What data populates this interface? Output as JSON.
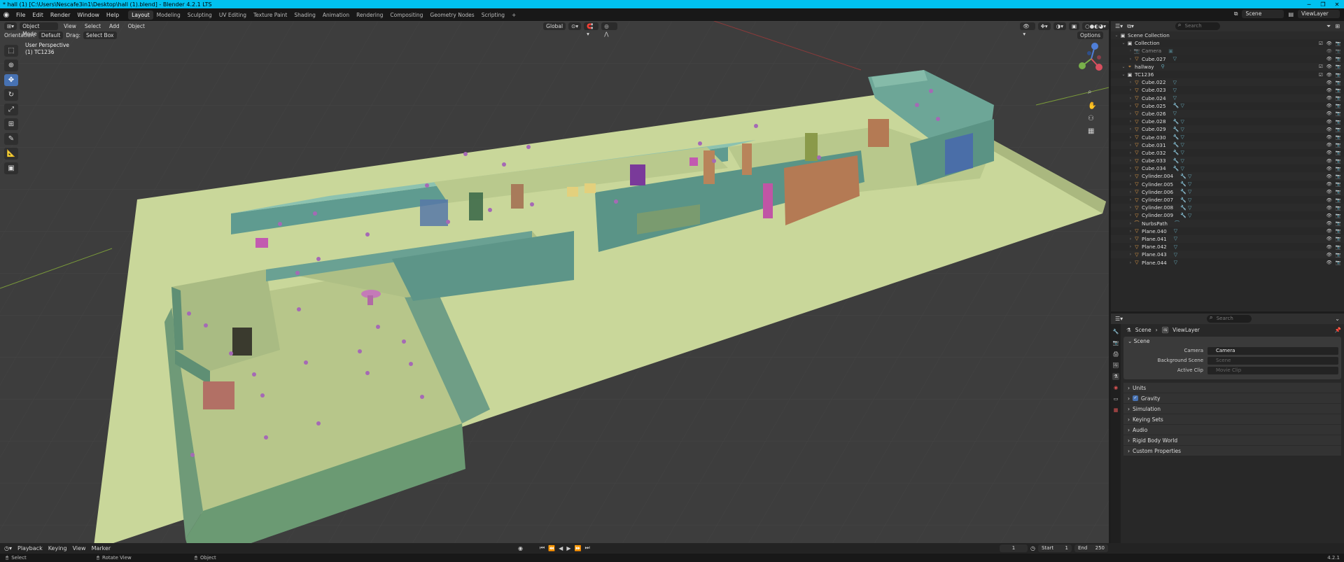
{
  "window": {
    "title": "* hall (1) [C:\\Users\\Nescafe3in1\\Desktop\\hall (1).blend] - Blender 4.2.1 LTS",
    "minimize": "─",
    "maximize": "❐",
    "close": "✕"
  },
  "menu": [
    "File",
    "Edit",
    "Render",
    "Window",
    "Help"
  ],
  "workspaces": [
    "Layout",
    "Modeling",
    "Sculpting",
    "UV Editing",
    "Texture Paint",
    "Shading",
    "Animation",
    "Rendering",
    "Compositing",
    "Geometry Nodes",
    "Scripting",
    "+"
  ],
  "active_workspace": "Layout",
  "top_right": {
    "scene": "Scene",
    "view_layer": "ViewLayer"
  },
  "viewport": {
    "mode": "Object Mode",
    "menus": [
      "View",
      "Select",
      "Add",
      "Object"
    ],
    "transform_orientation": "Global",
    "orientation_label": "Orientation:",
    "orientation_value": "Default",
    "drag_label": "Drag:",
    "drag_value": "Select Box",
    "options": "Options",
    "perspective": "User Perspective",
    "collection_info": "(1) TC1236"
  },
  "outliner": {
    "search_placeholder": "Search",
    "rows": [
      {
        "label": "Scene Collection",
        "indent": 0,
        "icon": "collection",
        "mods": ""
      },
      {
        "label": "Collection",
        "indent": 1,
        "icon": "collection",
        "mods": ""
      },
      {
        "label": "Camera",
        "indent": 2,
        "icon": "camera",
        "mods": "▣",
        "dim": true
      },
      {
        "label": "Cube.027",
        "indent": 2,
        "icon": "mesh",
        "mods": "▽"
      },
      {
        "label": "hallway",
        "indent": 1,
        "icon": "empty",
        "mods": "⚲"
      },
      {
        "label": "TC1236",
        "indent": 1,
        "icon": "collection",
        "mods": ""
      },
      {
        "label": "Cube.022",
        "indent": 2,
        "icon": "mesh",
        "mods": "▽"
      },
      {
        "label": "Cube.023",
        "indent": 2,
        "icon": "mesh",
        "mods": "▽"
      },
      {
        "label": "Cube.024",
        "indent": 2,
        "icon": "mesh",
        "mods": "▽"
      },
      {
        "label": "Cube.025",
        "indent": 2,
        "icon": "mesh",
        "mods": "🔧 ▽"
      },
      {
        "label": "Cube.026",
        "indent": 2,
        "icon": "mesh",
        "mods": "▽"
      },
      {
        "label": "Cube.028",
        "indent": 2,
        "icon": "mesh",
        "mods": "🔧 ▽"
      },
      {
        "label": "Cube.029",
        "indent": 2,
        "icon": "mesh",
        "mods": "🔧 ▽"
      },
      {
        "label": "Cube.030",
        "indent": 2,
        "icon": "mesh",
        "mods": "🔧 ▽"
      },
      {
        "label": "Cube.031",
        "indent": 2,
        "icon": "mesh",
        "mods": "🔧 ▽"
      },
      {
        "label": "Cube.032",
        "indent": 2,
        "icon": "mesh",
        "mods": "🔧 ▽"
      },
      {
        "label": "Cube.033",
        "indent": 2,
        "icon": "mesh",
        "mods": "🔧 ▽"
      },
      {
        "label": "Cube.034",
        "indent": 2,
        "icon": "mesh",
        "mods": "🔧 ▽"
      },
      {
        "label": "Cylinder.004",
        "indent": 2,
        "icon": "mesh",
        "mods": "🔧 ▽"
      },
      {
        "label": "Cylinder.005",
        "indent": 2,
        "icon": "mesh",
        "mods": "🔧 ▽"
      },
      {
        "label": "Cylinder.006",
        "indent": 2,
        "icon": "mesh",
        "mods": "🔧 ▽"
      },
      {
        "label": "Cylinder.007",
        "indent": 2,
        "icon": "mesh",
        "mods": "🔧 ▽"
      },
      {
        "label": "Cylinder.008",
        "indent": 2,
        "icon": "mesh",
        "mods": "🔧 ▽"
      },
      {
        "label": "Cylinder.009",
        "indent": 2,
        "icon": "mesh",
        "mods": "🔧 ▽"
      },
      {
        "label": "NurbsPath",
        "indent": 2,
        "icon": "curve",
        "mods": "⌒"
      },
      {
        "label": "Plane.040",
        "indent": 2,
        "icon": "mesh",
        "mods": "▽"
      },
      {
        "label": "Plane.041",
        "indent": 2,
        "icon": "mesh",
        "mods": "▽"
      },
      {
        "label": "Plane.042",
        "indent": 2,
        "icon": "mesh",
        "mods": "▽"
      },
      {
        "label": "Plane.043",
        "indent": 2,
        "icon": "mesh",
        "mods": "▽"
      },
      {
        "label": "Plane.044",
        "indent": 2,
        "icon": "mesh",
        "mods": "▽"
      }
    ]
  },
  "properties": {
    "search_placeholder": "Search",
    "breadcrumb": [
      "Scene",
      "ViewLayer"
    ],
    "scene_panel": "Scene",
    "fields": [
      {
        "label": "Camera",
        "value": "Camera",
        "placeholder": false
      },
      {
        "label": "Background Scene",
        "value": "Scene",
        "placeholder": true
      },
      {
        "label": "Active Clip",
        "value": "Movie Clip",
        "placeholder": true
      }
    ],
    "sections": [
      "Units",
      "Gravity",
      "Simulation",
      "Keying Sets",
      "Audio",
      "Rigid Body World",
      "Custom Properties"
    ]
  },
  "timeline": {
    "menus": [
      "Playback",
      "Keying",
      "View",
      "Marker"
    ],
    "current_frame": "1",
    "start_label": "Start",
    "start": "1",
    "end_label": "End",
    "end": "250"
  },
  "status": {
    "select": "Select",
    "rotate": "Rotate View",
    "object": "Object",
    "version": "4.2.1"
  },
  "colors": {
    "accent": "#4772b3",
    "title_bar": "#00c1f0",
    "floor": "#c9d79a",
    "walls": "#6fa38d",
    "grid_bg": "#3d3d3d"
  }
}
